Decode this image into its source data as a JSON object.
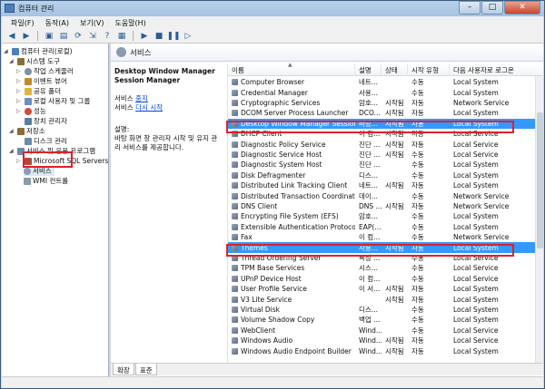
{
  "window": {
    "title": "컴퓨터 관리",
    "minimize": "–",
    "maximize": "□",
    "close": "✕"
  },
  "menu": [
    "파일(F)",
    "동작(A)",
    "보기(V)",
    "도움말(H)"
  ],
  "toolbar": [
    "back-arrow",
    "forward-arrow",
    "up-folder",
    "console-tree",
    "refresh",
    "export",
    "help",
    "properties",
    "play",
    "stop",
    "pause",
    "restart"
  ],
  "tree": [
    {
      "label": "컴퓨터 관리(로컬)",
      "icon_color": "#4c7fb8"
    },
    {
      "label": "시스템 도구",
      "icon_color": "#8a6d3b"
    },
    {
      "label": "작업 스케줄러",
      "icon_color": "#7a8fa8"
    },
    {
      "label": "이벤트 뷰어",
      "icon_color": "#c08a2b"
    },
    {
      "label": "공유 폴더",
      "icon_color": "#e2b13c"
    },
    {
      "label": "로컬 사용자 및 그룹",
      "icon_color": "#6a8ec1"
    },
    {
      "label": "성능",
      "icon_color": "#d04a3a"
    },
    {
      "label": "장치 관리자",
      "icon_color": "#5b7da3"
    },
    {
      "label": "저장소",
      "icon_color": "#8a6d3b"
    },
    {
      "label": "디스크 관리",
      "icon_color": "#6c8aa8"
    },
    {
      "label": "서비스 및 응용 프로그램",
      "icon_color": "#6c8aa8"
    },
    {
      "label": "Microsoft SQL Servers",
      "icon_color": "#b0493a"
    },
    {
      "label": "서비스",
      "icon_color": "#8a9bb0"
    },
    {
      "label": "WMI 컨트롤",
      "icon_color": "#8a9bb0"
    }
  ],
  "main_header": {
    "title": "서비스"
  },
  "desc": {
    "service_name": "Desktop Window Manager Session Manager",
    "stop_prefix": "서비스 ",
    "stop_link": "중지",
    "restart_prefix": "서비스 ",
    "restart_link": "다시 시작",
    "desc_label": "설명:",
    "desc_text": "바탕 화면 창 관리자 시작 및 유지 관리 서비스를 제공합니다."
  },
  "columns": [
    "이름",
    "설명",
    "상태",
    "시작 유형",
    "다음 사용자로 로그온"
  ],
  "rows": [
    [
      "Computer Browser",
      "네트...",
      "",
      "수동",
      "Local System"
    ],
    [
      "Credential Manager",
      "사용...",
      "",
      "수동",
      "Local System"
    ],
    [
      "Cryptographic Services",
      "암호...",
      "시작됨",
      "자동",
      "Network Service"
    ],
    [
      "DCOM Server Process Launcher",
      "DCO...",
      "시작됨",
      "자동",
      "Local System"
    ],
    [
      "Desktop Window Manager Session Ma...",
      "바탕...",
      "시작됨",
      "자동",
      "Local System"
    ],
    [
      "DHCP Client",
      "이 컴...",
      "시작됨",
      "자동",
      "Local Service"
    ],
    [
      "Diagnostic Policy Service",
      "진단 ...",
      "시작됨",
      "자동",
      "Local Service"
    ],
    [
      "Diagnostic Service Host",
      "진단 ...",
      "시작됨",
      "수동",
      "Local Service"
    ],
    [
      "Diagnostic System Host",
      "진단 ...",
      "",
      "수동",
      "Local System"
    ],
    [
      "Disk Defragmenter",
      "디스...",
      "",
      "수동",
      "Local System"
    ],
    [
      "Distributed Link Tracking Client",
      "네트...",
      "시작됨",
      "자동",
      "Local System"
    ],
    [
      "Distributed Transaction Coordinator",
      "데이...",
      "",
      "수동",
      "Network Service"
    ],
    [
      "DNS Client",
      "DNS ...",
      "시작됨",
      "자동",
      "Network Service"
    ],
    [
      "Encrypting File System (EFS)",
      "암호...",
      "",
      "수동",
      "Local System"
    ],
    [
      "Extensible Authentication Protocol",
      "EAP(...",
      "",
      "수동",
      "Local System"
    ],
    [
      "Fax",
      "이 컴...",
      "",
      "수동",
      "Network Service"
    ],
    [
      "Themes",
      "사용...",
      "시작됨",
      "자동",
      "Local System"
    ],
    [
      "Thread Ordering Server",
      "특정 ...",
      "",
      "수동",
      "Local Service"
    ],
    [
      "TPM Base Services",
      "시스...",
      "",
      "수동",
      "Local Service"
    ],
    [
      "UPnP Device Host",
      "이 컴...",
      "",
      "수동",
      "Local Service"
    ],
    [
      "User Profile Service",
      "이 서...",
      "시작됨",
      "자동",
      "Local System"
    ],
    [
      "V3 Lite Service",
      "",
      "시작됨",
      "자동",
      "Local System"
    ],
    [
      "Virtual Disk",
      "디스...",
      "",
      "수동",
      "Local System"
    ],
    [
      "Volume Shadow Copy",
      "백업 ...",
      "",
      "수동",
      "Local System"
    ],
    [
      "WebClient",
      "Wind...",
      "",
      "수동",
      "Local Service"
    ],
    [
      "Windows Audio",
      "Wind...",
      "시작됨",
      "자동",
      "Local Service"
    ],
    [
      "Windows Audio Endpoint Builder",
      "Wind...",
      "시작됨",
      "자동",
      "Local System"
    ]
  ],
  "highlight_rows": [
    4,
    16
  ],
  "tabs": [
    "확장",
    "표준"
  ],
  "colors": {
    "highlight": "#3399ff",
    "annotation": "#e0202a"
  }
}
